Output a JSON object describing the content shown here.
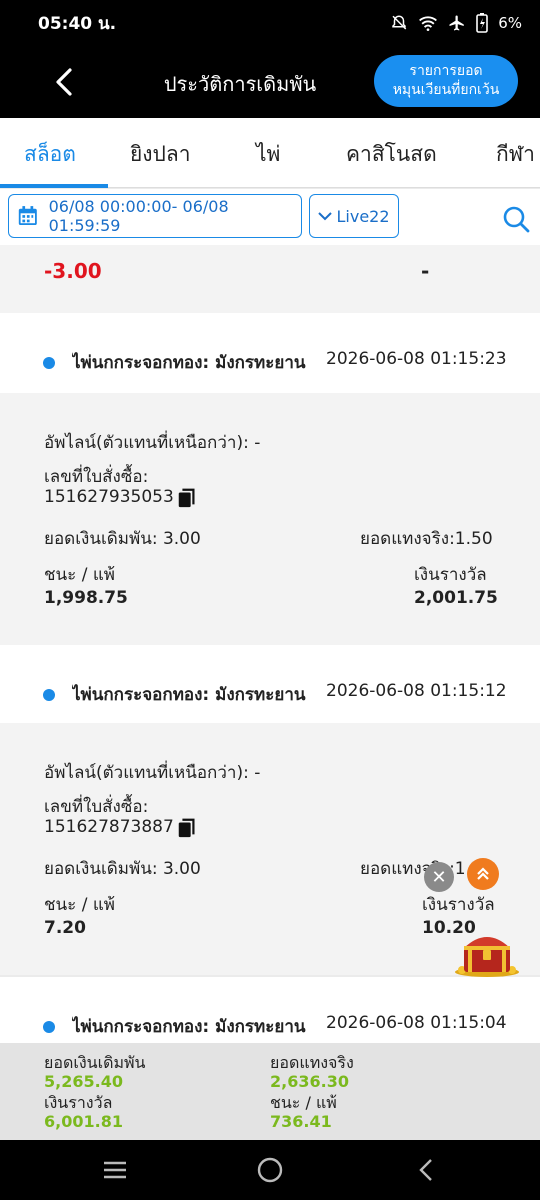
{
  "status_bar": {
    "time": "05:40 น.",
    "battery": "6%"
  },
  "header": {
    "title": "ประวัติการเดิมพัน",
    "exclude_line1": "รายการยอด",
    "exclude_line2": "หมุนเวียนที่ยกเว้น"
  },
  "tabs": [
    "สล็อต",
    "ยิงปลา",
    "ไพ่",
    "คาสิโนสด",
    "กีฬา"
  ],
  "filters": {
    "date_range": "06/08 00:00:00- 06/08 01:59:59",
    "game": "Live22"
  },
  "partial_record": {
    "win_loss": "-3.00",
    "prize": "-"
  },
  "records": [
    {
      "game": "ไพ่นกกระจอกทอง: มังกรทะยาน",
      "time": "2026-06-08 01:15:23",
      "upline": "อัพไลน์(ตัวแทนที่เหนือกว่า): -",
      "order_label": "เลขที่ใบสั่งซื้อ:",
      "order_no": "151627935053",
      "bet": "ยอดเงินเดิมพัน: 3.00",
      "valid_bet": "ยอดแทงจริง:1.50",
      "win_loss_label": "ชนะ / แพ้",
      "win_loss": "1,998.75",
      "prize_label": "เงินรางวัล",
      "prize": "2,001.75"
    },
    {
      "game": "ไพ่นกกระจอกทอง: มังกรทะยาน",
      "time": "2026-06-08 01:15:12",
      "upline": "อัพไลน์(ตัวแทนที่เหนือกว่า): -",
      "order_label": "เลขที่ใบสั่งซื้อ:",
      "order_no": "151627873887",
      "bet": "ยอดเงินเดิมพัน: 3.00",
      "valid_bet": "ยอดแทงจริง:1.50",
      "win_loss_label": "ชนะ / แพ้",
      "win_loss": "7.20",
      "prize_label": "เงินรางวัล",
      "prize": "10.20"
    },
    {
      "game": "ไพ่นกกระจอกทอง: มังกรทะยาน",
      "time": "2026-06-08 01:15:04"
    }
  ],
  "summary": {
    "bet_label": "ยอดเงินเดิมพัน",
    "bet": "5,265.40",
    "valid_label": "ยอดแทงจริง",
    "valid": "2,636.30",
    "prize_label": "เงินรางวัล",
    "prize": "6,001.81",
    "winloss_label": "ชนะ / แพ้",
    "winloss": "736.41"
  },
  "colors": {
    "accent": "#1a8ae6",
    "win": "#7bb91e",
    "loss": "#e0141e",
    "float_up": "#f07b1e"
  }
}
